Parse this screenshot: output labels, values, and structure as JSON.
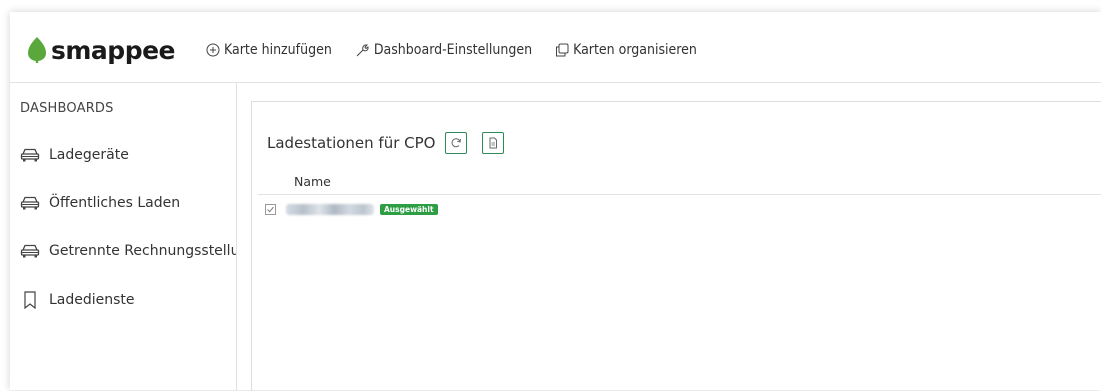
{
  "brand": {
    "name": "smappee",
    "color": "#5aa83c"
  },
  "topnav": {
    "add_card": "Karte hinzufügen",
    "dashboard_settings": "Dashboard-Einstellungen",
    "organize_cards": "Karten organisieren"
  },
  "sidebar": {
    "heading": "DASHBOARDS",
    "items": [
      {
        "label": "Ladegeräte",
        "icon": "car-icon"
      },
      {
        "label": "Öffentliches Laden",
        "icon": "car-icon"
      },
      {
        "label": "Getrennte Rechnungsstellung",
        "icon": "car-icon"
      },
      {
        "label": "Ladedienste",
        "icon": "bookmark-icon"
      }
    ]
  },
  "card": {
    "title": "Ladestationen für CPO",
    "columns": [
      "Name"
    ],
    "rows": [
      {
        "name": "",
        "checked": true,
        "badge": "Ausgewählt"
      }
    ]
  },
  "colors": {
    "accent_green": "#2e9e45",
    "button_border": "#2e8b57"
  }
}
